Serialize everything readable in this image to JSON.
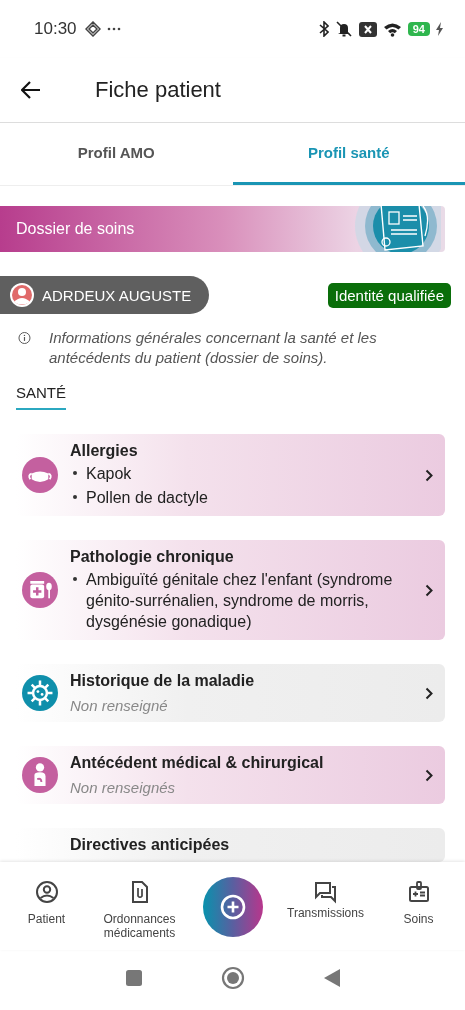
{
  "status_bar": {
    "time": "10:30",
    "battery": "94"
  },
  "header": {
    "title": "Fiche patient"
  },
  "tabs": [
    {
      "label": "Profil AMO",
      "selected": false
    },
    {
      "label": "Profil santé",
      "selected": true
    }
  ],
  "banner": {
    "title": "Dossier de soins"
  },
  "patient": {
    "name": "ADRDEUX AUGUSTE",
    "badge": "Identité qualifiée"
  },
  "info": "Informations générales concernant la santé et les antécédents du patient (dossier de soins).",
  "section": "SANTÉ",
  "cards": [
    {
      "kind": "allergy",
      "title": "Allergies",
      "color": "#c4609f",
      "items": [
        "Kapok",
        "Pollen de dactyle"
      ]
    },
    {
      "kind": "chronic",
      "title": "Pathologie chronique",
      "color": "#c4609f",
      "items": [
        "Ambiguïté génitale chez l'enfant (syndrome génito-surrénalien, syndrome de morris, dysgénésie gonadique)"
      ]
    },
    {
      "kind": "history",
      "title": "Historique de la maladie",
      "color": "#0f8fab",
      "note": "Non renseigné"
    },
    {
      "kind": "surgery",
      "title": "Antécédent médical & chirurgical",
      "color": "#c4609f",
      "note": "Non renseignés"
    },
    {
      "kind": "directive",
      "title": "Directives anticipées"
    }
  ],
  "bottom_nav": [
    {
      "kind": "patient",
      "label": "Patient"
    },
    {
      "kind": "prescriptions",
      "label": "Ordonnances médicaments"
    },
    {
      "kind": "add"
    },
    {
      "kind": "transmissions",
      "label": "Transmissions"
    },
    {
      "kind": "care",
      "label": "Soins"
    }
  ]
}
